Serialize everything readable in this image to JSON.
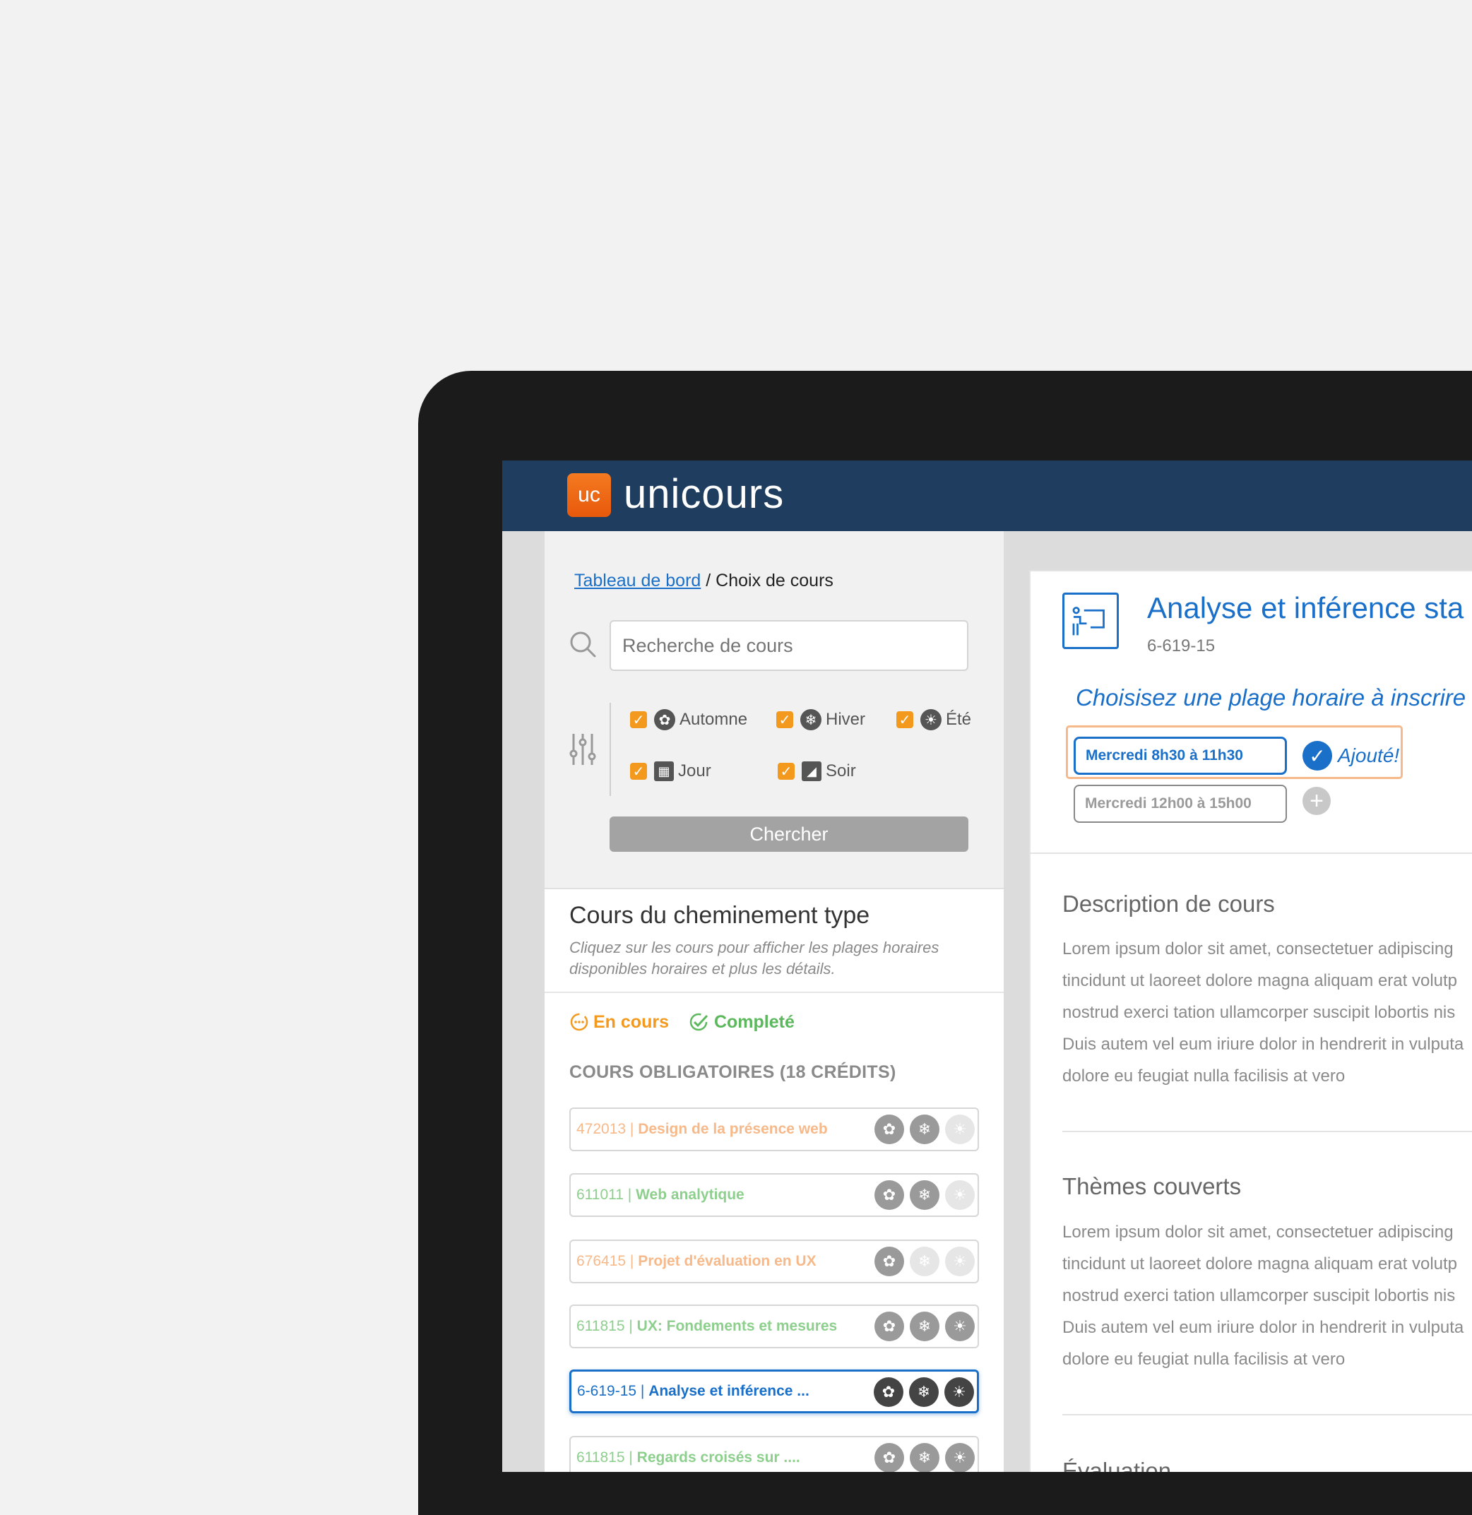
{
  "app": {
    "logo_badge": "uc",
    "name": "unicours"
  },
  "breadcrumb": {
    "link": "Tableau de bord",
    "separator": " / ",
    "current": "Choix de cours"
  },
  "search": {
    "placeholder": "Recherche de cours",
    "button": "Chercher"
  },
  "filters": {
    "seasons": [
      {
        "label": "Automne",
        "checked": true,
        "icon": "maple-leaf-icon"
      },
      {
        "label": "Hiver",
        "checked": true,
        "icon": "snowflake-icon"
      },
      {
        "label": "Été",
        "checked": true,
        "icon": "sun-icon"
      }
    ],
    "times": [
      {
        "label": "Jour",
        "checked": true,
        "icon": "day-icon"
      },
      {
        "label": "Soir",
        "checked": true,
        "icon": "evening-icon"
      }
    ]
  },
  "path": {
    "title": "Cours du cheminement type",
    "subtitle": "Cliquez sur les cours pour afficher les plages horaires disponibles horaires et plus les détails.",
    "legend": {
      "in_progress": "En cours",
      "completed": "Completé"
    },
    "section": "COURS OBLIGATOIRES (18 CRÉDITS)",
    "courses": [
      {
        "code": "472013",
        "name": "Design de la présence web",
        "status": "in-progress",
        "seasons": [
          true,
          true,
          false
        ]
      },
      {
        "code": "611011",
        "name": "Web analytique",
        "status": "completed",
        "seasons": [
          true,
          true,
          false
        ]
      },
      {
        "code": "676415",
        "name": "Projet d'évaluation en UX",
        "status": "in-progress",
        "seasons": [
          true,
          false,
          false
        ]
      },
      {
        "code": "611815",
        "name": "UX: Fondements et mesures",
        "status": "completed",
        "seasons": [
          true,
          true,
          true
        ]
      },
      {
        "code": "6-619-15",
        "name": "Analyse et inférence ...",
        "status": "selected",
        "seasons": [
          true,
          true,
          true
        ]
      },
      {
        "code": "611815",
        "name": "Regards croisés sur ....",
        "status": "completed",
        "seasons": [
          true,
          true,
          true
        ]
      }
    ]
  },
  "detail": {
    "title": "Analyse et inférence sta",
    "code": "6-619-15",
    "choose_label": "Choisisez une plage horaire à inscrire",
    "slots": [
      {
        "label": "Mercredi 8h30 à 11h30",
        "added": true
      },
      {
        "label": "Mercredi 12h00 à 15h00",
        "added": false
      }
    ],
    "added_label": "Ajouté!",
    "description_title": "Description de cours",
    "description_lines": [
      "Lorem ipsum dolor sit amet, consectetuer adipiscing",
      "tincidunt ut laoreet dolore magna aliquam erat volutp",
      "nostrud exerci tation ullamcorper suscipit lobortis nis",
      "Duis autem vel eum iriure dolor in hendrerit in vulputa",
      "dolore eu feugiat nulla facilisis at vero"
    ],
    "themes_title": "Thèmes couverts",
    "themes_lines": [
      "Lorem ipsum dolor sit amet, consectetuer adipiscing",
      "tincidunt ut laoreet dolore magna aliquam erat volutp",
      "nostrud exerci tation ullamcorper suscipit lobortis nis",
      "Duis autem vel eum iriure dolor in hendrerit in vulputa",
      "dolore eu feugiat nulla facilisis at vero"
    ],
    "evaluation_title": "Évaluation"
  },
  "colors": {
    "brand_navy": "#1e3d5f",
    "accent_orange": "#f39a1e",
    "link_blue": "#1a6fc9",
    "completed_green": "#5cb85c"
  }
}
